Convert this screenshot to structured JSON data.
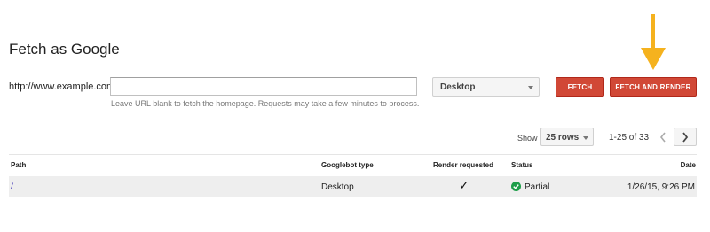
{
  "title": "Fetch as Google",
  "form": {
    "base_url": "http://www.example.com/",
    "url_value": "",
    "url_placeholder": "",
    "helper_text": "Leave URL blank to fetch the homepage. Requests may take a few minutes to process.",
    "device_selected": "Desktop",
    "fetch_label": "FETCH",
    "fetch_render_label": "FETCH AND RENDER"
  },
  "colors": {
    "primary_button": "#d14836",
    "annotation_arrow": "#f5b21e",
    "status_ok": "#1e9e4a",
    "link": "#1a0dab"
  },
  "pagination": {
    "show_label": "Show",
    "rows_selected": "25 rows",
    "range": "1-25 of 33"
  },
  "table": {
    "headers": {
      "path": "Path",
      "type": "Googlebot type",
      "render": "Render requested",
      "status": "Status",
      "date": "Date"
    },
    "rows": [
      {
        "path": "/",
        "googlebot_type": "Desktop",
        "render_requested": "✓",
        "status_icon": "check-circle-icon",
        "status": "Partial",
        "date": "1/26/15, 9:26 PM"
      }
    ]
  }
}
